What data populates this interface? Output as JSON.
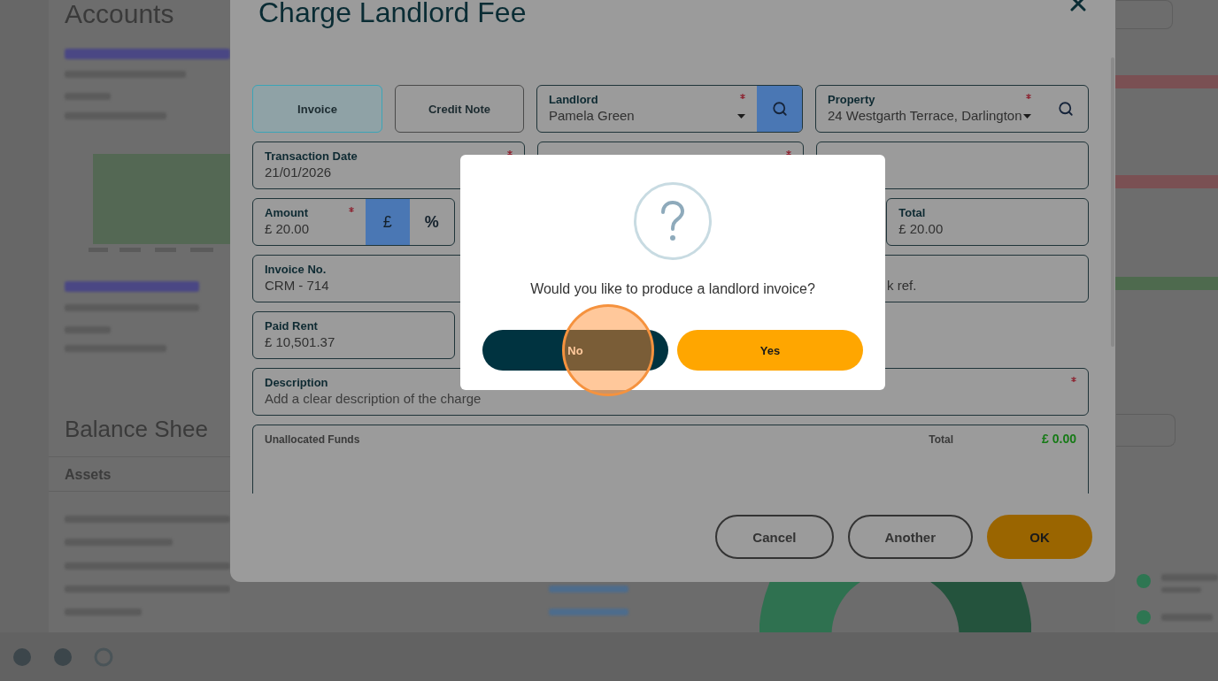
{
  "background": {
    "accounts_title": "Accounts",
    "balance_sheet_title": "Balance Shee",
    "table_header": "Assets"
  },
  "modal": {
    "title": "Charge Landlord Fee",
    "transaction_types": [
      {
        "label": "Invoice",
        "selected": true
      },
      {
        "label": "Credit Note",
        "selected": false
      }
    ],
    "landlord": {
      "label": "Landlord",
      "value": "Pamela Green",
      "required": true,
      "search_highlighted": true
    },
    "property": {
      "label": "Property",
      "value": "24 Westgarth Terrace, Darlington",
      "required": true,
      "search_highlighted": false
    },
    "transaction_date": {
      "label": "Transaction Date",
      "value": "21/01/2026",
      "required": true
    },
    "field_2_2": {
      "required": true
    },
    "amount": {
      "label": "Amount",
      "value": "£ 20.00",
      "required": true,
      "units": [
        {
          "label": "£",
          "selected": true
        },
        {
          "label": "%",
          "selected": false
        }
      ]
    },
    "total": {
      "label": "Total",
      "value": "£ 20.00"
    },
    "invoice_no": {
      "label": "Invoice No.",
      "value": "CRM - 714"
    },
    "field_4_2": {
      "value": "k ref."
    },
    "paid_rent": {
      "label": "Paid Rent",
      "value": "£ 10,501.37"
    },
    "description": {
      "label": "Description",
      "placeholder": "Add a clear description of the charge",
      "required": true
    },
    "unallocated_funds": {
      "title": "Unallocated Funds",
      "total_label": "Total",
      "total": "£ 0.00"
    },
    "buttons": [
      {
        "label": "Cancel",
        "kind": "outline"
      },
      {
        "label": "Another",
        "kind": "outline"
      },
      {
        "label": "OK",
        "kind": "primary"
      }
    ]
  },
  "dialog": {
    "message": "Would you like to produce a landlord invoice?",
    "buttons": [
      {
        "label": "No",
        "kind": "dark"
      },
      {
        "label": "Yes",
        "kind": "accent"
      }
    ]
  }
}
